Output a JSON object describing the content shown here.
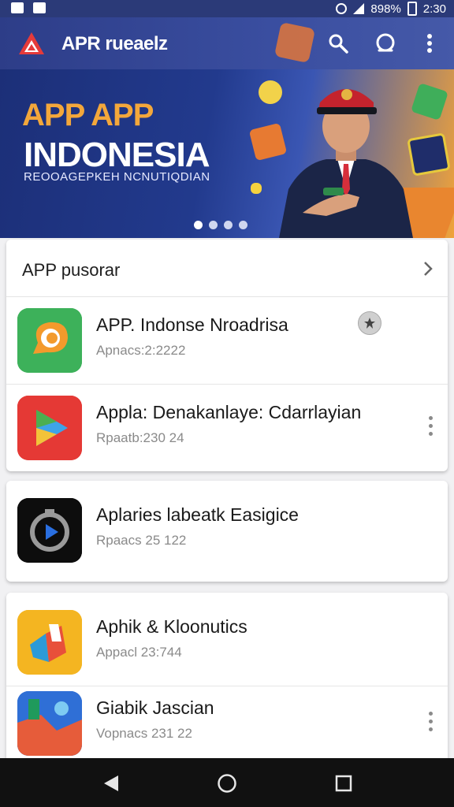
{
  "status_bar": {
    "carrier": "898%",
    "time": "2:30"
  },
  "app_bar": {
    "title": "APR rueaelz"
  },
  "banner": {
    "headline_1": "APP APP",
    "headline_2": "INDONESIA",
    "subtitle": "REOOAGEPKEH NCNUTIQDIAN",
    "slide_count": 4,
    "active_slide": 1
  },
  "section": {
    "title": "APP pusorar"
  },
  "apps": [
    {
      "name": "APP. Indonse Nroadrisa",
      "meta": "Apnacs:2:2222"
    },
    {
      "name": "Appla: Denakanlaye: Cdarrlayian",
      "meta": "Rpaatb:230 24"
    },
    {
      "name": "Aplaries labeatk Easigice",
      "meta": "Rpaacs 25 122"
    },
    {
      "name": "Aphik & Kloonutics",
      "meta": "Appacl 23:744"
    },
    {
      "name": "Giabik Jascian",
      "meta": "Vopnacs 231 22"
    }
  ],
  "colors": {
    "app_bar": "#3a4ea0",
    "banner": "#223a8d",
    "accent": "#f3a73b"
  }
}
